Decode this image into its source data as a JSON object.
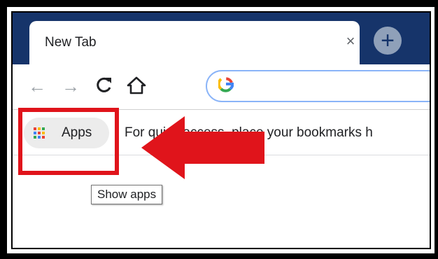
{
  "tab": {
    "title": "New Tab",
    "close_glyph": "×"
  },
  "new_tab_glyph": "+",
  "toolbar": {
    "back_glyph": "←",
    "forward_glyph": "→",
    "reload_glyph": "C",
    "home_glyph": "⌂",
    "search_logo": "G"
  },
  "bookmarks_bar": {
    "apps_label": "Apps",
    "hint_text": "For quick access, place your bookmarks h"
  },
  "tooltip": {
    "text": "Show apps"
  },
  "icons": {
    "apps_grid_colors": [
      "#ea4335",
      "#fbbc04",
      "#34a853",
      "#4285f4",
      "#ea4335",
      "#fbbc04",
      "#34a853",
      "#4285f4",
      "#ea4335"
    ]
  },
  "colors": {
    "tabstrip": "#16346a",
    "annotation_red": "#e0141b",
    "omnibox_border": "#8ab4f8"
  }
}
